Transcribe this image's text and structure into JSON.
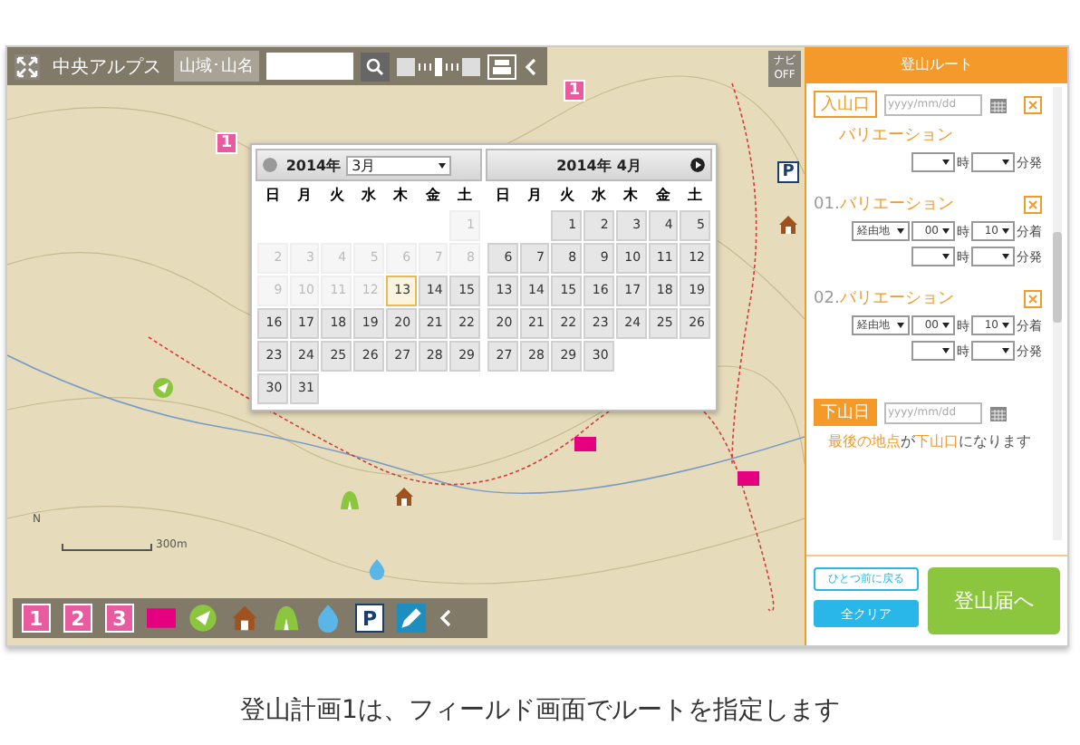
{
  "toolbar": {
    "area_name": "中央アルプス",
    "area_button": "山域･山名",
    "zoom": {
      "level": 0.5
    },
    "navi_button": "ナビ OFF"
  },
  "map": {
    "scale_label": "300m",
    "north_label": "N",
    "pins": [
      {
        "kind": "number",
        "label": "1"
      },
      {
        "kind": "number",
        "label": "1"
      },
      {
        "kind": "flag"
      },
      {
        "kind": "flag"
      },
      {
        "kind": "house"
      },
      {
        "kind": "house"
      },
      {
        "kind": "water"
      },
      {
        "kind": "parking",
        "label": "P"
      },
      {
        "kind": "arrow"
      },
      {
        "kind": "tent"
      }
    ]
  },
  "calendar": {
    "months": [
      {
        "year": "2014年",
        "month": "3月",
        "month_select": true,
        "weekdays": [
          "日",
          "月",
          "火",
          "水",
          "木",
          "金",
          "土"
        ],
        "prev_button": true,
        "next_button": false,
        "days": [
          {
            "d": "1",
            "disabled": true
          },
          {
            "d": "2",
            "disabled": true
          },
          {
            "d": "3",
            "disabled": true
          },
          {
            "d": "4",
            "disabled": true
          },
          {
            "d": "5",
            "disabled": true
          },
          {
            "d": "6",
            "disabled": true
          },
          {
            "d": "7",
            "disabled": true
          },
          {
            "d": "8",
            "disabled": true
          },
          {
            "d": "9",
            "disabled": true
          },
          {
            "d": "10",
            "disabled": true
          },
          {
            "d": "11",
            "disabled": true
          },
          {
            "d": "12",
            "disabled": true
          },
          {
            "d": "13",
            "disabled": false,
            "today": true
          },
          {
            "d": "14",
            "disabled": false
          },
          {
            "d": "15",
            "disabled": false
          },
          {
            "d": "16",
            "disabled": false
          },
          {
            "d": "17",
            "disabled": false
          },
          {
            "d": "18",
            "disabled": false
          },
          {
            "d": "19",
            "disabled": false
          },
          {
            "d": "20",
            "disabled": false
          },
          {
            "d": "21",
            "disabled": false
          },
          {
            "d": "22",
            "disabled": false
          },
          {
            "d": "23",
            "disabled": false
          },
          {
            "d": "24",
            "disabled": false
          },
          {
            "d": "25",
            "disabled": false
          },
          {
            "d": "26",
            "disabled": false
          },
          {
            "d": "27",
            "disabled": false
          },
          {
            "d": "28",
            "disabled": false
          },
          {
            "d": "29",
            "disabled": false
          },
          {
            "d": "30",
            "disabled": false
          },
          {
            "d": "31",
            "disabled": false
          }
        ]
      },
      {
        "year": "2014年",
        "month": "4月",
        "month_select": false,
        "weekdays": [
          "日",
          "月",
          "火",
          "水",
          "木",
          "金",
          "土"
        ],
        "prev_button": false,
        "next_button": true,
        "days": [
          {
            "d": "1",
            "disabled": false
          },
          {
            "d": "2",
            "disabled": false
          },
          {
            "d": "3",
            "disabled": false
          },
          {
            "d": "4",
            "disabled": false
          },
          {
            "d": "5",
            "disabled": false
          },
          {
            "d": "6",
            "disabled": false
          },
          {
            "d": "7",
            "disabled": false
          },
          {
            "d": "8",
            "disabled": false
          },
          {
            "d": "9",
            "disabled": false
          },
          {
            "d": "10",
            "disabled": false
          },
          {
            "d": "11",
            "disabled": false
          },
          {
            "d": "12",
            "disabled": false
          },
          {
            "d": "13",
            "disabled": false
          },
          {
            "d": "14",
            "disabled": false
          },
          {
            "d": "15",
            "disabled": false
          },
          {
            "d": "16",
            "disabled": false
          },
          {
            "d": "17",
            "disabled": false
          },
          {
            "d": "18",
            "disabled": false
          },
          {
            "d": "19",
            "disabled": false
          },
          {
            "d": "20",
            "disabled": false
          },
          {
            "d": "21",
            "disabled": false
          },
          {
            "d": "22",
            "disabled": false
          },
          {
            "d": "23",
            "disabled": false
          },
          {
            "d": "24",
            "disabled": false
          },
          {
            "d": "25",
            "disabled": false
          },
          {
            "d": "26",
            "disabled": false
          },
          {
            "d": "27",
            "disabled": false
          },
          {
            "d": "28",
            "disabled": false
          },
          {
            "d": "29",
            "disabled": false
          },
          {
            "d": "30",
            "disabled": false
          }
        ]
      }
    ]
  },
  "bottom_toolbar": [
    {
      "kind": "number",
      "label": "1"
    },
    {
      "kind": "number",
      "label": "2"
    },
    {
      "kind": "number",
      "label": "3"
    },
    {
      "kind": "flag"
    },
    {
      "kind": "arrow"
    },
    {
      "kind": "house"
    },
    {
      "kind": "tent"
    },
    {
      "kind": "water"
    },
    {
      "kind": "parking",
      "label": "P"
    },
    {
      "kind": "pen"
    },
    {
      "kind": "collapse"
    }
  ],
  "panel": {
    "title": "登山ルート",
    "entries": [
      {
        "kind": "start",
        "badge": "入山口",
        "date_placeholder": "yyyy/mm/dd",
        "heading": "バリエーション",
        "rows": [
          {
            "times": [
              {
                "unit": "時"
              },
              {
                "unit": "分発"
              }
            ]
          }
        ]
      },
      {
        "kind": "waypoint",
        "number": "01.",
        "heading": "バリエーション",
        "rows": [
          {
            "route_select": "経由地",
            "times": [
              {
                "value": "00",
                "unit": "時"
              },
              {
                "value": "10",
                "unit": "分着"
              }
            ]
          },
          {
            "times": [
              {
                "unit": "時"
              },
              {
                "unit": "分発"
              }
            ]
          }
        ]
      },
      {
        "kind": "waypoint",
        "number": "02.",
        "heading": "バリエーション",
        "rows": [
          {
            "route_select": "経由地",
            "times": [
              {
                "value": "00",
                "unit": "時"
              },
              {
                "value": "10",
                "unit": "分着"
              }
            ]
          },
          {
            "times": [
              {
                "unit": "時"
              },
              {
                "unit": "分発"
              }
            ]
          }
        ]
      },
      {
        "kind": "end",
        "badge": "下山日",
        "date_placeholder": "yyyy/mm/dd",
        "note": [
          {
            "text": "最後の地点",
            "highlight": true
          },
          {
            "text": "が",
            "highlight": false
          },
          {
            "text": "下山口",
            "highlight": true
          },
          {
            "text": "になります",
            "highlight": false
          }
        ]
      }
    ],
    "back_button": "ひとつ前に戻る",
    "clear_button": "全クリア",
    "submit_button": "登山届へ"
  },
  "caption": "登山計画1は、フィールド画面でルートを指定します"
}
